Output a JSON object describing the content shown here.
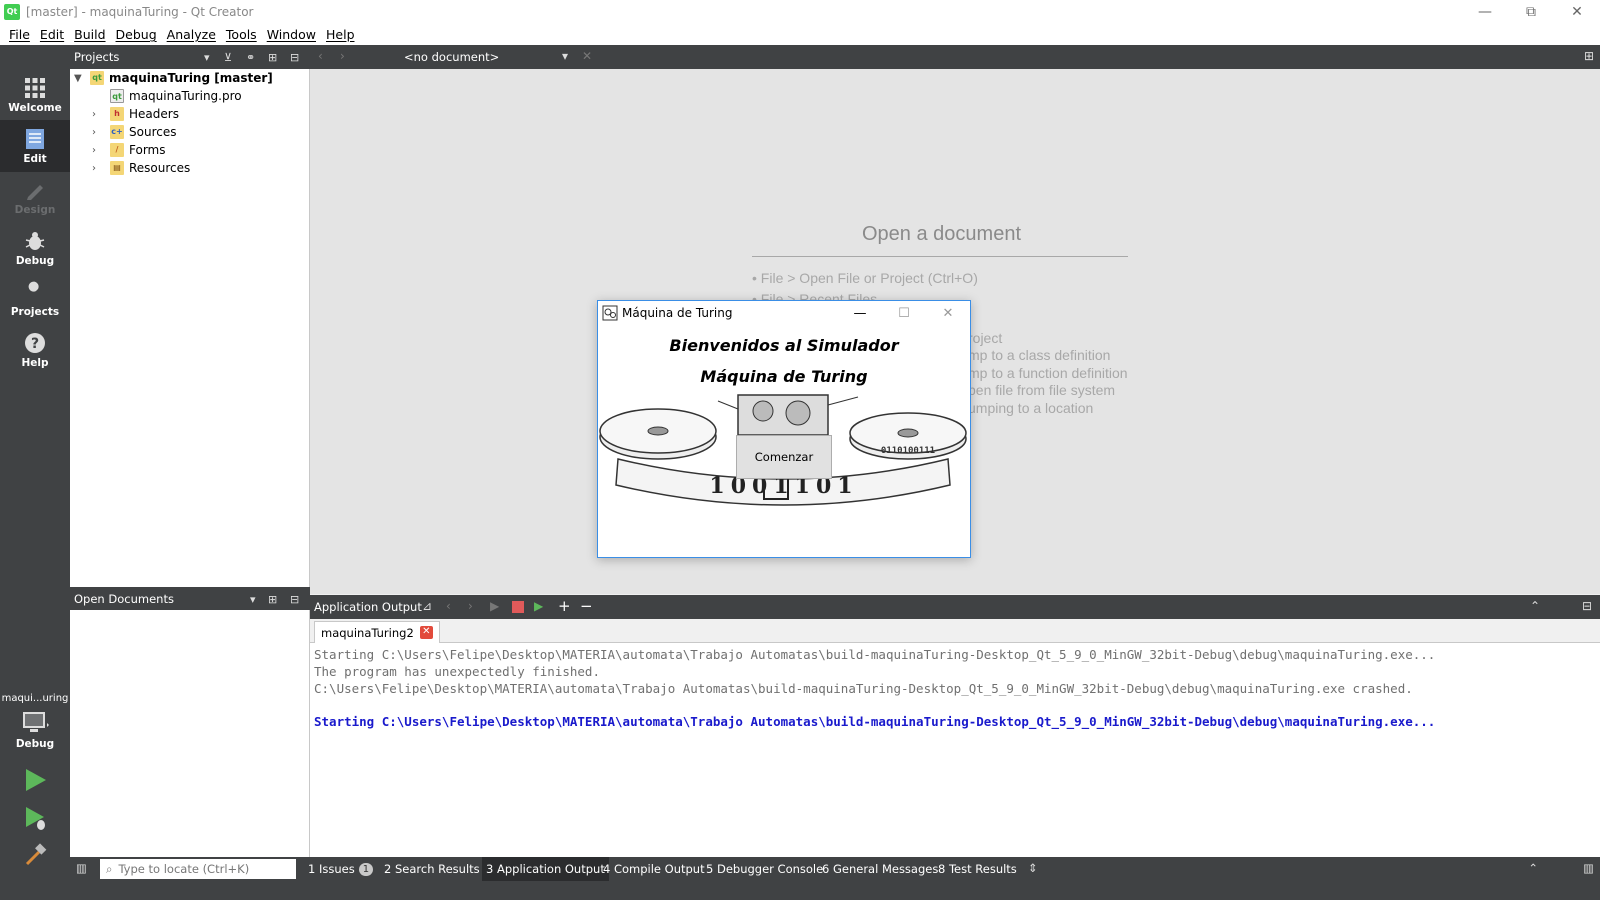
{
  "window": {
    "title": "[master] - maquinaTuring - Qt Creator",
    "app_icon": "Qt",
    "minimize": "—",
    "restore": "⧉",
    "close": "✕"
  },
  "menu": [
    "File",
    "Edit",
    "Build",
    "Debug",
    "Analyze",
    "Tools",
    "Window",
    "Help"
  ],
  "modes": {
    "welcome": "Welcome",
    "edit": "Edit",
    "design": "Design",
    "debug": "Debug",
    "projects": "Projects",
    "help": "Help"
  },
  "kit": {
    "label": "maqui...uring",
    "mode": "Debug"
  },
  "projects_pane": {
    "title": "Projects",
    "root": "maquinaTuring [master]",
    "items": [
      "maquinaTuring.pro",
      "Headers",
      "Sources",
      "Forms",
      "Resources"
    ]
  },
  "open_documents": {
    "title": "Open Documents"
  },
  "editor": {
    "doc_selector": "<no document>",
    "open_title": "Open a document",
    "hints": [
      "• File > Open File or Project (Ctrl+O)",
      "• File > Recent Files",
      "roject",
      "mp to a class definition",
      "mp to a function definition",
      "pen file from file system",
      "umping to a location"
    ]
  },
  "output": {
    "title": "Application Output",
    "tab": "maquinaTuring2",
    "lines": [
      "Starting C:\\Users\\Felipe\\Desktop\\MATERIA\\automata\\Trabajo Automatas\\build-maquinaTuring-Desktop_Qt_5_9_0_MinGW_32bit-Debug\\debug\\maquinaTuring.exe...",
      "The program has unexpectedly finished.",
      "C:\\Users\\Felipe\\Desktop\\MATERIA\\automata\\Trabajo Automatas\\build-maquinaTuring-Desktop_Qt_5_9_0_MinGW_32bit-Debug\\debug\\maquinaTuring.exe crashed.",
      "Starting C:\\Users\\Felipe\\Desktop\\MATERIA\\automata\\Trabajo Automatas\\build-maquinaTuring-Desktop_Qt_5_9_0_MinGW_32bit-Debug\\debug\\maquinaTuring.exe..."
    ]
  },
  "statusbar": {
    "locator_placeholder": "Type to locate (Ctrl+K)",
    "issues": "1  Issues",
    "issues_count": "1",
    "search": "2  Search Results",
    "app_output": "3  Application Output",
    "compile": "4  Compile Output",
    "debugger": "5  Debugger Console",
    "general": "6  General Messages",
    "tests": "8  Test Results"
  },
  "dialog": {
    "title": "Máquina de Turing",
    "line1": "Bienvenidos al Simulador",
    "line2": "Máquina de Turing",
    "tape": "1001101",
    "tape_small": "0110100111",
    "start_button": "Comenzar"
  },
  "colors": {
    "sidebar": "#404244",
    "active_mode": "#2b2c2e",
    "editor_bg": "#e4e4e4",
    "output_blue": "#1a1acc",
    "dialog_border": "#3a8ee6"
  }
}
